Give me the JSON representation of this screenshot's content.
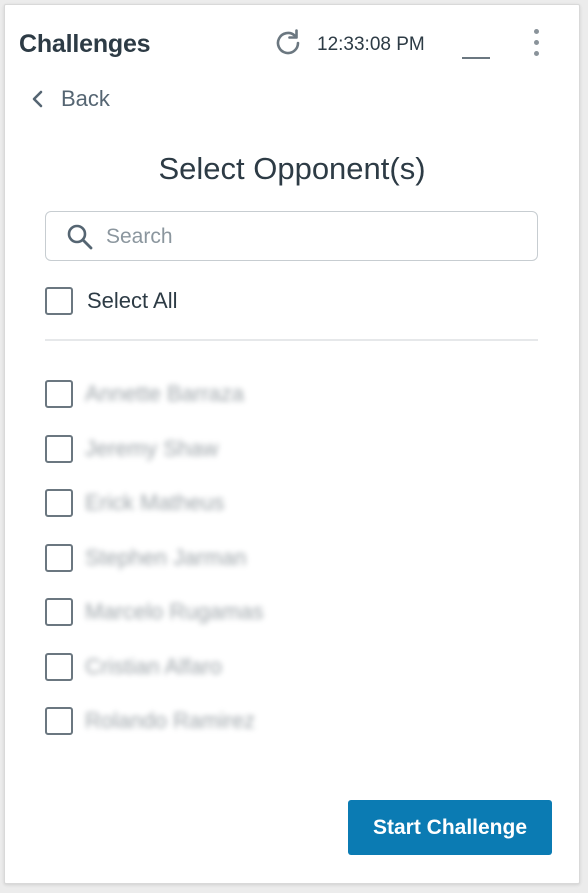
{
  "header": {
    "title": "Challenges",
    "clock": "12:33:08 PM",
    "refresh_icon": "refresh-icon",
    "minimize_icon": "minimize-icon",
    "more_icon": "more-vertical-icon"
  },
  "back": {
    "label": "Back",
    "icon": "chevron-left-icon"
  },
  "page_title": "Select Opponent(s)",
  "search": {
    "placeholder": "Search",
    "value": "",
    "icon": "search-icon"
  },
  "select_all": {
    "label": "Select All",
    "checked": false
  },
  "opponents": [
    {
      "name": "Annette Barraza",
      "checked": false
    },
    {
      "name": "Jeremy Shaw",
      "checked": false
    },
    {
      "name": "Erick Matheus",
      "checked": false
    },
    {
      "name": "Stephen Jarman",
      "checked": false
    },
    {
      "name": "Marcelo Rugamas",
      "checked": false
    },
    {
      "name": "Cristian Alfaro",
      "checked": false
    },
    {
      "name": "Rolando Ramirez",
      "checked": false
    }
  ],
  "start_button": {
    "label": "Start Challenge"
  },
  "colors": {
    "accent": "#0b7bb3",
    "text": "#2d3b45",
    "muted": "#556572",
    "border": "#c7cdd1"
  }
}
